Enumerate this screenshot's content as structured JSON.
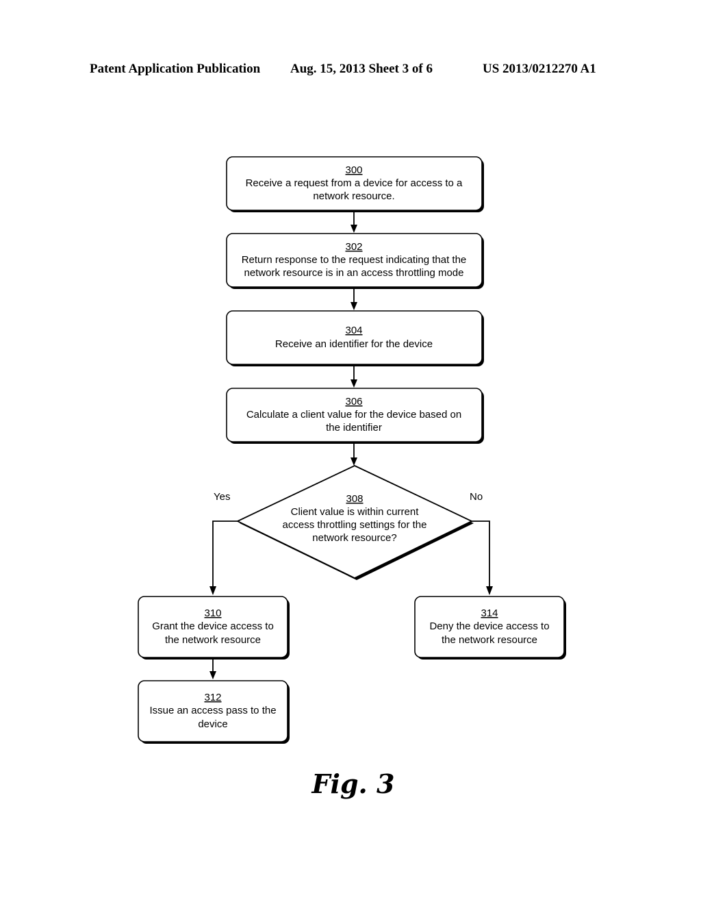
{
  "header": {
    "left": "Patent Application Publication",
    "middle": "Aug. 15, 2013  Sheet 3 of 6",
    "right": "US 2013/0212270 A1"
  },
  "steps": {
    "s300": {
      "number": "300",
      "lines": [
        "Receive a request from a device for access to a",
        "network resource."
      ]
    },
    "s302": {
      "number": "302",
      "lines": [
        "Return response to the request indicating that the",
        "network resource is in an access throttling mode"
      ]
    },
    "s304": {
      "number": "304",
      "lines": [
        "Receive an identifier for the device"
      ]
    },
    "s306": {
      "number": "306",
      "lines": [
        "Calculate a client value for the device based on",
        "the identifier"
      ]
    },
    "s308": {
      "number": "308",
      "lines": [
        "Client value is within current",
        "access throttling settings for the",
        "network resource?"
      ]
    },
    "s310": {
      "number": "310",
      "lines": [
        "Grant the device access to",
        "the network resource"
      ]
    },
    "s312": {
      "number": "312",
      "lines": [
        "Issue an access pass to the",
        "device"
      ]
    },
    "s314": {
      "number": "314",
      "lines": [
        "Deny the device access to",
        "the network resource"
      ]
    }
  },
  "branches": {
    "yes": "Yes",
    "no": "No"
  },
  "figure_label": "Fig. 3"
}
